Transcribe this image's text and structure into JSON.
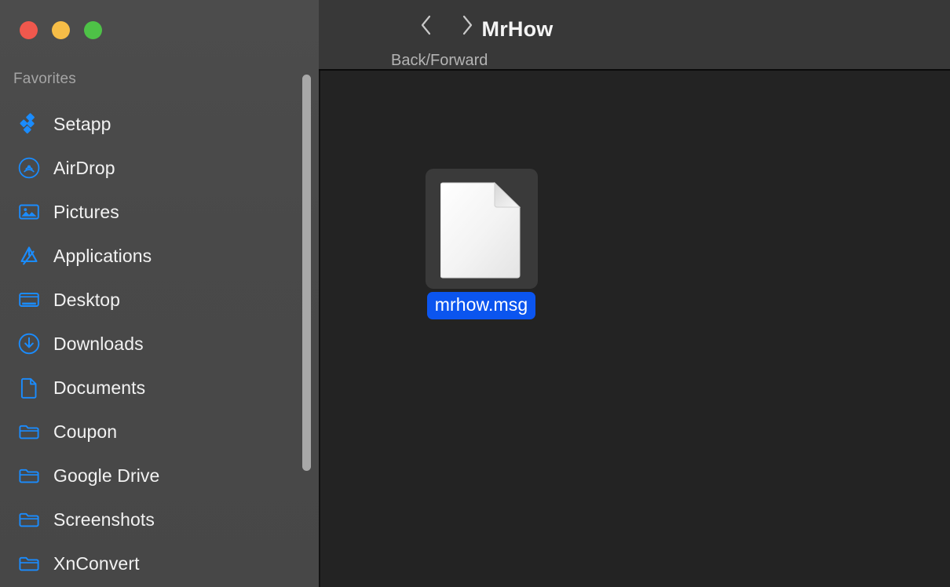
{
  "window": {
    "title": "MrHow",
    "traffic_lights": [
      {
        "name": "close",
        "color": "#f0584d"
      },
      {
        "name": "minimize",
        "color": "#f6bd47"
      },
      {
        "name": "zoom",
        "color": "#4ec247"
      }
    ]
  },
  "toolbar": {
    "title": "MrHow",
    "nav_caption": "Back/Forward",
    "back_icon": "chevron-left-icon",
    "forward_icon": "chevron-right-icon"
  },
  "sidebar": {
    "section_label": "Favorites",
    "items": [
      {
        "label": "Setapp",
        "icon": "setapp-icon"
      },
      {
        "label": "AirDrop",
        "icon": "airdrop-icon"
      },
      {
        "label": "Pictures",
        "icon": "pictures-icon"
      },
      {
        "label": "Applications",
        "icon": "applications-icon"
      },
      {
        "label": "Desktop",
        "icon": "desktop-icon"
      },
      {
        "label": "Downloads",
        "icon": "downloads-icon"
      },
      {
        "label": "Documents",
        "icon": "documents-icon"
      },
      {
        "label": "Coupon",
        "icon": "folder-icon"
      },
      {
        "label": "Google Drive",
        "icon": "folder-icon"
      },
      {
        "label": "Screenshots",
        "icon": "folder-icon"
      },
      {
        "label": "XnConvert",
        "icon": "folder-icon"
      }
    ],
    "accent_color": "#1a8cff"
  },
  "content": {
    "files": [
      {
        "name": "mrhow.msg",
        "icon": "generic-document-icon",
        "selected": true
      }
    ],
    "selection_color": "#0b55ef"
  }
}
